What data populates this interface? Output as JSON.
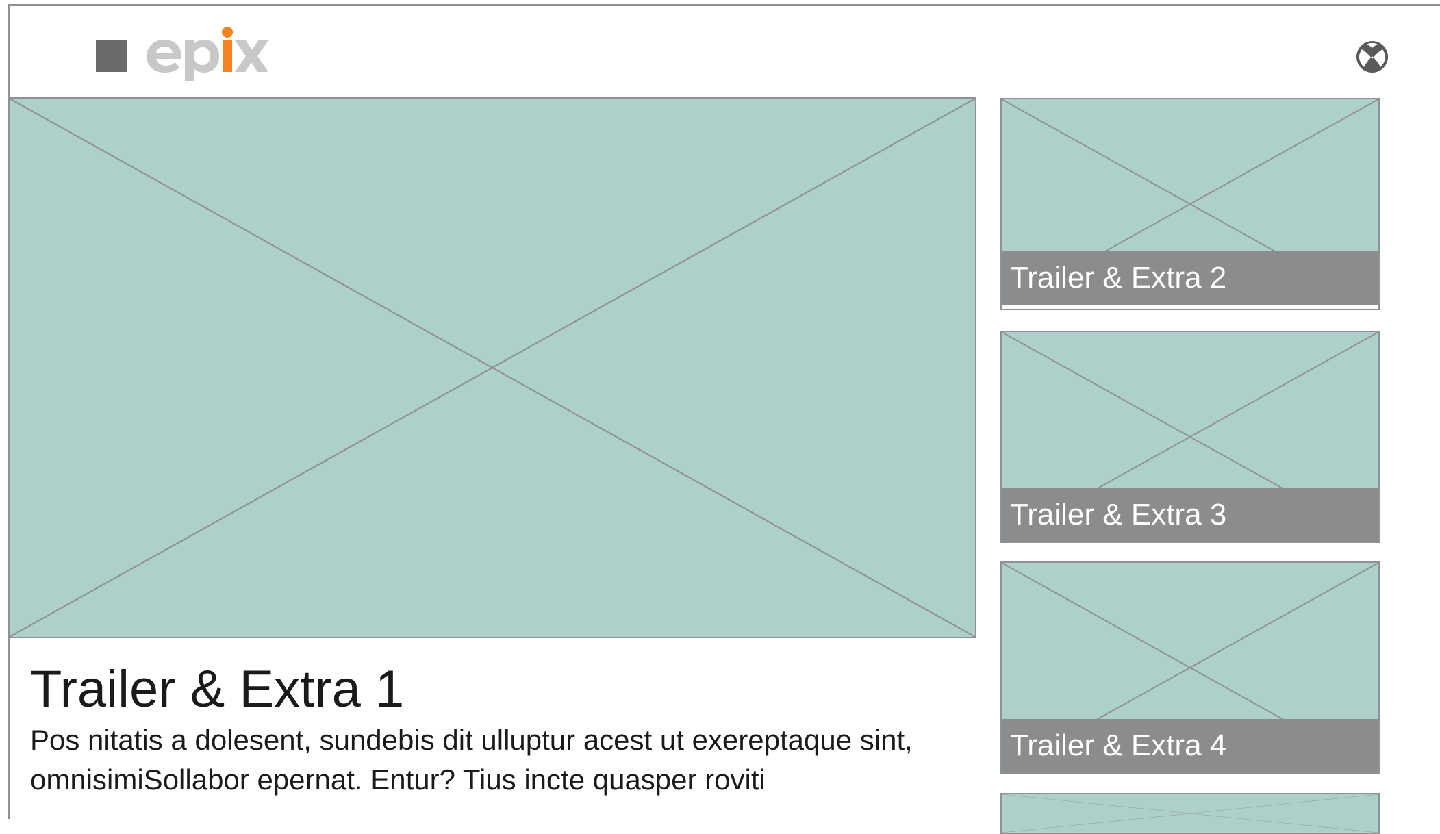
{
  "header": {
    "logo_text": "epix",
    "logo_square_color": "#6b6b6b",
    "logo_letter_color": "#c7c8ca",
    "logo_accent_color": "#f58220",
    "platform_icon": "xbox-icon"
  },
  "hero": {
    "image": "image-placeholder",
    "title": "Trailer & Extra 1",
    "description": "Pos nitatis a dolesent, sundebis dit ulluptur acest ut exereptaque sint, omnisimiSollabor epernat. Entur? Tius incte quasper roviti"
  },
  "extras": [
    {
      "label": "Trailer & Extra 2"
    },
    {
      "label": "Trailer & Extra 3"
    },
    {
      "label": "Trailer & Extra 4"
    },
    {
      "label": ""
    }
  ],
  "colors": {
    "placeholder_fill": "#add0ca",
    "placeholder_stroke": "#8f9294",
    "caption_bar": "#8a8c8e",
    "text": "#1a1a1a"
  }
}
